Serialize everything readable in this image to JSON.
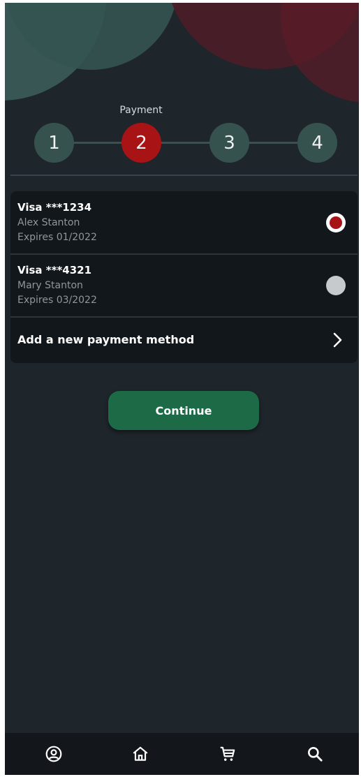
{
  "stepper": {
    "caption": "Payment",
    "steps": [
      "1",
      "2",
      "3",
      "4"
    ],
    "active_step": 2
  },
  "payment_methods": [
    {
      "title": "Visa ***1234",
      "name": "Alex Stanton",
      "expires": "Expires 01/2022",
      "selected": true
    },
    {
      "title": "Visa ***4321",
      "name": "Mary Stanton",
      "expires": "Expires 03/2022",
      "selected": false
    }
  ],
  "add_method": {
    "label": "Add a new payment method"
  },
  "continue_label": "Continue",
  "bottom_nav": {
    "items": [
      "account-icon",
      "home-icon",
      "cart-icon",
      "search-icon"
    ]
  },
  "colors": {
    "background": "#1e252b",
    "active_step": "#a81315",
    "inactive_step": "#36524f",
    "button": "#1c6a46"
  }
}
